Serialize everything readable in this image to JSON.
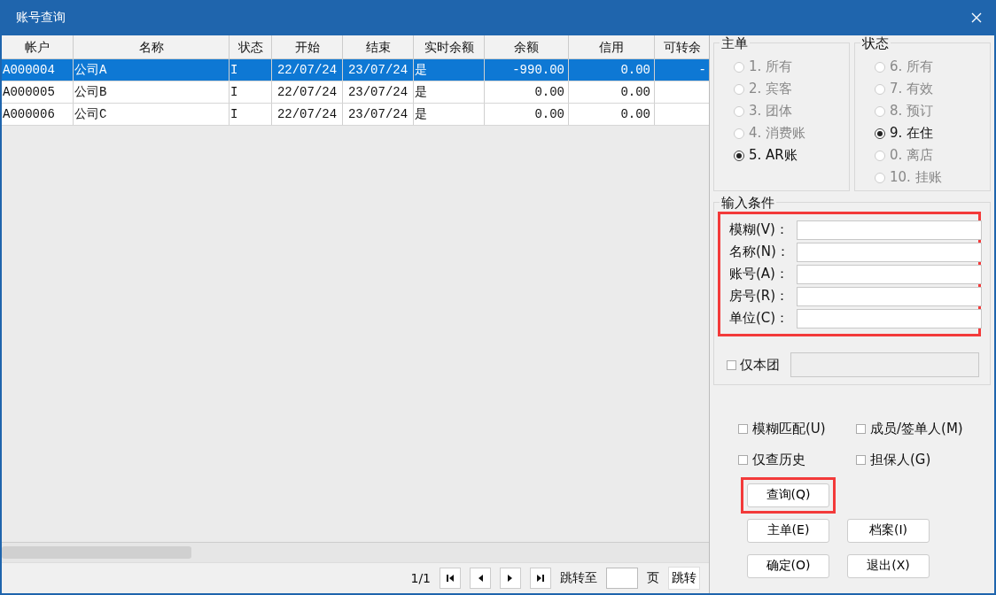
{
  "window": {
    "title": "账号查询"
  },
  "table": {
    "columns": [
      "帐户",
      "名称",
      "状态",
      "开始",
      "结束",
      "实时余额",
      "余额",
      "信用",
      "可转余"
    ],
    "rows": [
      {
        "selected": true,
        "cells": [
          "A000004",
          "公司A",
          "I",
          "22/07/24",
          "23/07/24",
          "是",
          "-990.00",
          "0.00",
          "-"
        ]
      },
      {
        "selected": false,
        "cells": [
          "A000005",
          "公司B",
          "I",
          "22/07/24",
          "23/07/24",
          "是",
          "0.00",
          "0.00"
        ]
      },
      {
        "selected": false,
        "cells": [
          "A000006",
          "公司C",
          "I",
          "22/07/24",
          "23/07/24",
          "是",
          "0.00",
          "0.00"
        ]
      }
    ]
  },
  "pager": {
    "page": "1/1",
    "jump_label": "跳转至",
    "page_unit": "页",
    "jump_button": "跳转"
  },
  "main_bill": {
    "title": "主单",
    "options": [
      {
        "label": "1. 所有",
        "selected": false
      },
      {
        "label": "2. 宾客",
        "selected": false
      },
      {
        "label": "3. 团体",
        "selected": false
      },
      {
        "label": "4. 消费账",
        "selected": false
      },
      {
        "label": "5. AR账",
        "selected": true
      }
    ]
  },
  "status": {
    "title": "状态",
    "options": [
      {
        "label": "6. 所有",
        "selected": false
      },
      {
        "label": "7. 有效",
        "selected": false
      },
      {
        "label": "8. 预订",
        "selected": false
      },
      {
        "label": "9. 在住",
        "selected": true
      },
      {
        "label": "0. 离店",
        "selected": false
      },
      {
        "label": "10. 挂账",
        "selected": false
      }
    ]
  },
  "input_conditions": {
    "title": "输入条件",
    "highlighted": true,
    "fields": [
      {
        "label": "模糊(V)："
      },
      {
        "label": "名称(N)："
      },
      {
        "label": "账号(A)："
      },
      {
        "label": "房号(R)："
      },
      {
        "label": "单位(C)："
      }
    ],
    "group_only": {
      "label": "仅本团",
      "checked": false
    }
  },
  "options": [
    {
      "label": "模糊匹配(U)",
      "checked": false
    },
    {
      "label": "成员/签单人(M)",
      "checked": false
    },
    {
      "label": "仅查历史",
      "checked": false
    },
    {
      "label": "担保人(G)",
      "checked": false
    }
  ],
  "buttons": [
    {
      "label": "查询(Q)",
      "highlighted": true
    },
    {
      "label": "主单(E)",
      "highlighted": false
    },
    {
      "label": "档案(I)",
      "highlighted": false
    },
    {
      "label": "确定(O)",
      "highlighted": false
    },
    {
      "label": "退出(X)",
      "highlighted": false
    }
  ]
}
